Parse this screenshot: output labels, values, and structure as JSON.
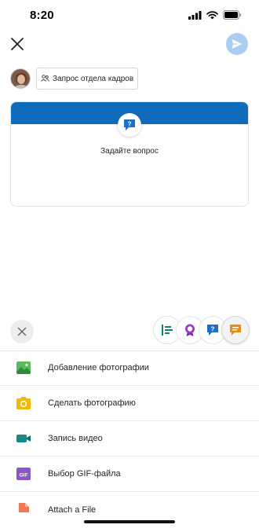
{
  "status_bar": {
    "time": "8:20"
  },
  "header": {
    "close_icon": "close-icon",
    "send_icon": "send-icon",
    "send_color": "#a9cdf3"
  },
  "audience": {
    "label": "Запрос отдела кадров"
  },
  "card": {
    "prompt": "Задайте вопрос",
    "band_color": "#0f6cbd",
    "icon": "question-bubble-icon"
  },
  "post_types": {
    "items": [
      "bar-list-icon",
      "badge-icon",
      "question-bubble-icon",
      "chat-bubble-icon"
    ],
    "selected": "chat-bubble-icon"
  },
  "actions": [
    {
      "label": "Добавление фотографии",
      "icon": "image-icon"
    },
    {
      "label": "Сделать фотографию",
      "icon": "camera-icon"
    },
    {
      "label": "Запись видео",
      "icon": "video-icon"
    },
    {
      "label": "Выбор GIF-файла",
      "icon": "gif-icon",
      "icon_text": "GIF"
    },
    {
      "label": "Attach a File",
      "icon": "file-icon"
    }
  ]
}
